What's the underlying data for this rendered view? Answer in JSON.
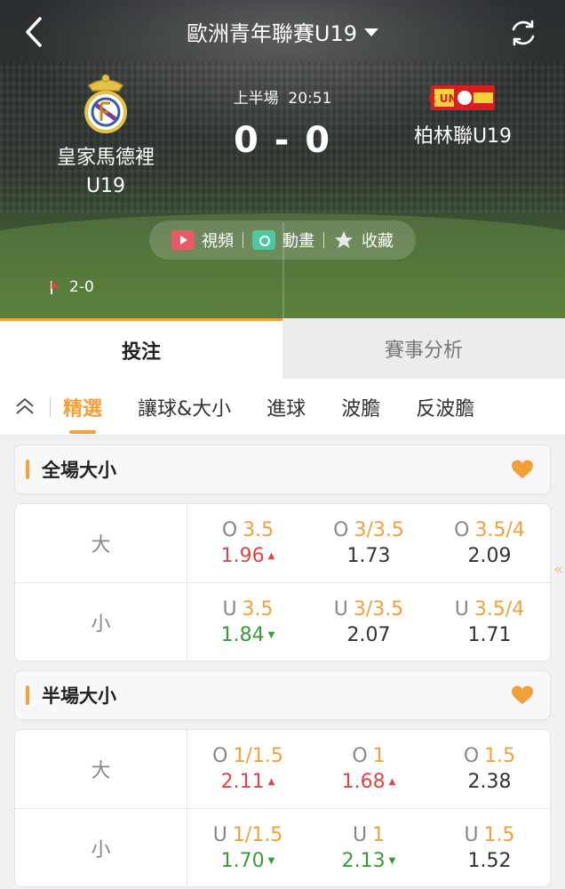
{
  "header": {
    "title": "歐洲青年聯賽U19",
    "home_team": {
      "name_line1": "皇家馬德裡",
      "name_line2": "U19"
    },
    "away_team": {
      "name_line1": "柏林聯U19",
      "logo_text": "1.FC UNION"
    },
    "period": "上半場",
    "time": "20:51",
    "score": "0 - 0",
    "media": {
      "video": "視頻",
      "animation": "動畫",
      "favorite": "收藏"
    },
    "corners": "2-0"
  },
  "main_tabs": [
    {
      "label": "投注",
      "active": true
    },
    {
      "label": "賽事分析",
      "active": false
    }
  ],
  "sub_tabs": [
    {
      "label": "精選",
      "active": true
    },
    {
      "label": "讓球&大小",
      "active": false
    },
    {
      "label": "進球",
      "active": false
    },
    {
      "label": "波膽",
      "active": false
    },
    {
      "label": "反波膽",
      "active": false
    }
  ],
  "sections": [
    {
      "title": "全場大小",
      "rows": [
        {
          "label": "大",
          "cells": [
            {
              "prefix": "O",
              "line": "3.5",
              "odds": "1.96",
              "trend": "up"
            },
            {
              "prefix": "O",
              "line": "3/3.5",
              "odds": "1.73",
              "trend": "none"
            },
            {
              "prefix": "O",
              "line": "3.5/4",
              "odds": "2.09",
              "trend": "none"
            }
          ]
        },
        {
          "label": "小",
          "cells": [
            {
              "prefix": "U",
              "line": "3.5",
              "odds": "1.84",
              "trend": "down"
            },
            {
              "prefix": "U",
              "line": "3/3.5",
              "odds": "2.07",
              "trend": "none"
            },
            {
              "prefix": "U",
              "line": "3.5/4",
              "odds": "1.71",
              "trend": "none"
            }
          ]
        }
      ]
    },
    {
      "title": "半場大小",
      "rows": [
        {
          "label": "大",
          "cells": [
            {
              "prefix": "O",
              "line": "1/1.5",
              "odds": "2.11",
              "trend": "up"
            },
            {
              "prefix": "O",
              "line": "1",
              "odds": "1.68",
              "trend": "up"
            },
            {
              "prefix": "O",
              "line": "1.5",
              "odds": "2.38",
              "trend": "none"
            }
          ]
        },
        {
          "label": "小",
          "cells": [
            {
              "prefix": "U",
              "line": "1/1.5",
              "odds": "1.70",
              "trend": "down"
            },
            {
              "prefix": "U",
              "line": "1",
              "odds": "2.13",
              "trend": "down"
            },
            {
              "prefix": "U",
              "line": "1.5",
              "odds": "1.52",
              "trend": "none"
            }
          ]
        }
      ]
    }
  ],
  "colors": {
    "accent": "#f0a13a",
    "up": "#e04545",
    "down": "#3a9a3a"
  }
}
